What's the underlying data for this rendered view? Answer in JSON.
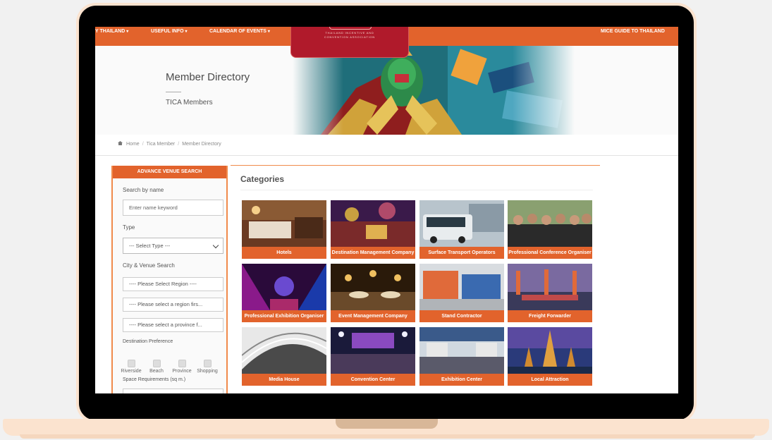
{
  "topnav": {
    "item1": "Y THAILAND",
    "item2": "USEFUL INFO",
    "item3": "CALENDAR OF EVENTS",
    "right_link": "MICE GUIDE TO THAILAND"
  },
  "logo": {
    "line1": "THAILAND INCENTIVE AND",
    "line2": "CONVENTION ASSOCIATION"
  },
  "hero": {
    "title": "Member Directory",
    "subtitle": "TICA Members"
  },
  "breadcrumb": {
    "home": "Home",
    "level2": "Tica Member",
    "current": "Member Directory"
  },
  "sidebar": {
    "header": "ADVANCE VENUE SEARCH",
    "search_label": "Search by name",
    "search_placeholder": "Enter name keyword",
    "type_label": "Type",
    "type_selected": "--- Select Type ---",
    "city_label": "City & Venue Search",
    "region": "---- Please Select Region ----",
    "region_first": "---- Please select a region firs...",
    "province_first": "---- Please select a province f...",
    "destination_label": "Destination Preference",
    "preferences": [
      "Riverside",
      "Beach",
      "Province",
      "Shopping"
    ],
    "space_label": "Space Requirements (sq m.)"
  },
  "categories": {
    "title": "Categories",
    "items": [
      "Hotels",
      "Destination Management Company",
      "Surface Transport Operators",
      "Professional Conference Organiser",
      "Professional Exhibition Organiser",
      "Event Management Company",
      "Stand Contractor",
      "Freight Forwarder",
      "Media House",
      "Convention Center",
      "Exhibition Center",
      "Local Attraction"
    ]
  },
  "colors": {
    "brand_orange": "#e2632c",
    "logo_red": "#b01a2b",
    "laptop_frame": "#fbe3cf"
  }
}
